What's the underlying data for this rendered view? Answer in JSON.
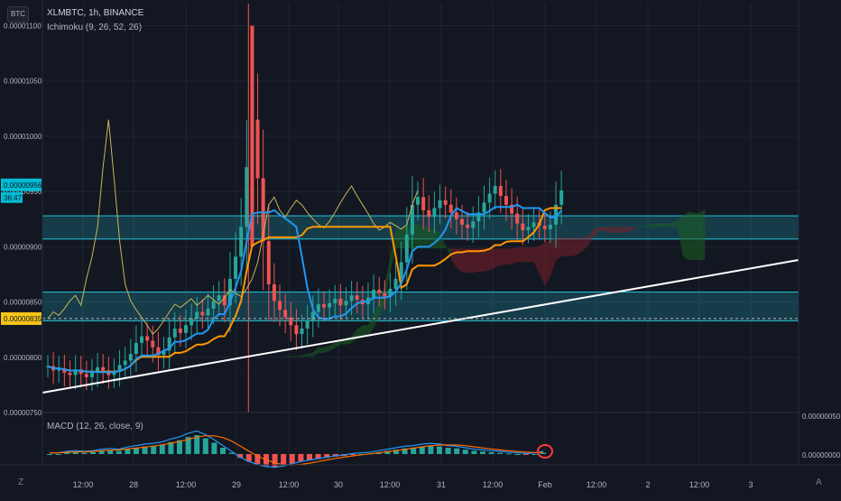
{
  "header": {
    "symbol_badge": "BTC",
    "title": "XLMBTC, 1h, BINANCE",
    "indicator": "Ichimoku (9, 26, 52, 26)",
    "macd_label": "MACD (12, 26, close, 9)"
  },
  "toolbar": {
    "left_button": "Z",
    "right_button": "A"
  },
  "price_axis": {
    "ticks": [
      "0.00001100",
      "0.00001050",
      "0.00001000",
      "0.00000950",
      "0.00000900",
      "0.00000850",
      "0.00000800",
      "0.00000750"
    ],
    "tick_values": [
      1.1e-05,
      1.05e-05,
      1e-05,
      9.5e-06,
      9e-06,
      8.5e-06,
      8e-06,
      7.5e-06
    ],
    "current_price": "0.00000956",
    "countdown": "36:47",
    "marker_price": "0.00000835",
    "marker_value": 8.35e-06
  },
  "macd_axis": {
    "ticks": [
      "0.00000050",
      "0.00000000"
    ]
  },
  "time_axis": {
    "ticks": [
      "12:00",
      "28",
      "12:00",
      "29",
      "12:00",
      "30",
      "12:00",
      "31",
      "12:00",
      "Feb",
      "12:00",
      "2",
      "12:00",
      "3"
    ]
  },
  "colors": {
    "background": "#131722",
    "grid": "#1f2433",
    "up": "#26a69a",
    "down": "#ef5350",
    "tenkan": "#2196f3",
    "kijun": "#ff9800",
    "chikou": "#c9b458",
    "cloud_bull": "#1b5e20",
    "cloud_bear": "#7b1f2a",
    "zone": "#26c6da",
    "trendline": "#ffffff",
    "price_label": "#00bcd4",
    "marker_label": "#f5c518",
    "macd_line": "#2196f3",
    "signal_line": "#ff6d00",
    "annotation": "#ff3b3b"
  },
  "chart_data": {
    "type": "candlestick",
    "symbol": "XLMBTC",
    "interval": "1h",
    "exchange": "BINANCE",
    "ylim": [
      7.5e-06,
      1.12e-05
    ],
    "grid": true,
    "last_price": 9.56e-06,
    "support_zones": [
      {
        "low": 9.07e-06,
        "high": 9.28e-06
      },
      {
        "low": 8.33e-06,
        "high": 8.59e-06
      }
    ],
    "trendline": {
      "from": [
        0,
        7.68e-06
      ],
      "to": [
        125,
        8.88e-06
      ]
    },
    "close": [
      7.92e-06,
      7.88e-06,
      7.9e-06,
      7.86e-06,
      7.84e-06,
      7.89e-06,
      7.85e-06,
      7.82e-06,
      7.86e-06,
      7.91e-06,
      7.88e-06,
      7.84e-06,
      7.87e-06,
      7.93e-06,
      7.97e-06,
      8.03e-06,
      8.13e-06,
      8.19e-06,
      8.15e-06,
      8.09e-06,
      8.02e-06,
      8.06e-06,
      8.18e-06,
      8.26e-06,
      8.22e-06,
      8.29e-06,
      8.35e-06,
      8.41e-06,
      8.38e-06,
      8.44e-06,
      8.51e-06,
      8.56e-06,
      8.47e-06,
      8.71e-06,
      8.91e-06,
      9.18e-06,
      9.72e-06,
      1.015e-05,
      9.62e-06,
      9.05e-06,
      8.66e-06,
      8.51e-06,
      8.43e-06,
      8.36e-06,
      8.29e-06,
      8.21e-06,
      8.26e-06,
      8.33e-06,
      8.41e-06,
      8.48e-06,
      8.45e-06,
      8.49e-06,
      8.53e-06,
      8.47e-06,
      8.51e-06,
      8.56e-06,
      8.52e-06,
      8.48e-06,
      8.54e-06,
      8.61e-06,
      8.58e-06,
      8.55e-06,
      8.62e-06,
      8.71e-06,
      8.86e-06,
      9.11e-06,
      9.38e-06,
      9.45e-06,
      9.33e-06,
      9.27e-06,
      9.35e-06,
      9.42e-06,
      9.38e-06,
      9.31e-06,
      9.25e-06,
      9.2e-06,
      9.17e-06,
      9.23e-06,
      9.31e-06,
      9.4e-06,
      9.48e-06,
      9.55e-06,
      9.46e-06,
      9.38e-06,
      9.3e-06,
      9.21e-06,
      9.15e-06,
      9.18e-06,
      9.22e-06,
      9.19e-06,
      9.16e-06,
      9.2e-06,
      9.38e-06,
      9.51e-06
    ],
    "kijun_last": 9.53e-06,
    "macd": {
      "histogram": [
        0,
        0,
        0.02,
        0.03,
        0.02,
        0.03,
        0.05,
        0.06,
        0.05,
        0.08,
        0.1,
        0.12,
        0.13,
        0.15,
        0.19,
        0.22,
        0.27,
        0.3,
        0.25,
        0.18,
        0.1,
        0.02,
        -0.06,
        -0.12,
        -0.16,
        -0.19,
        -0.2,
        -0.18,
        -0.15,
        -0.12,
        -0.1,
        -0.08,
        -0.06,
        -0.04,
        -0.03,
        -0.01,
        0,
        0.01,
        0.03,
        0.05,
        0.07,
        0.09,
        0.1,
        0.12,
        0.13,
        0.12,
        0.1,
        0.09,
        0.07,
        0.05,
        0.04,
        0.03,
        0.02,
        0.01,
        0,
        -0.01,
        0,
        0.02
      ]
    }
  }
}
